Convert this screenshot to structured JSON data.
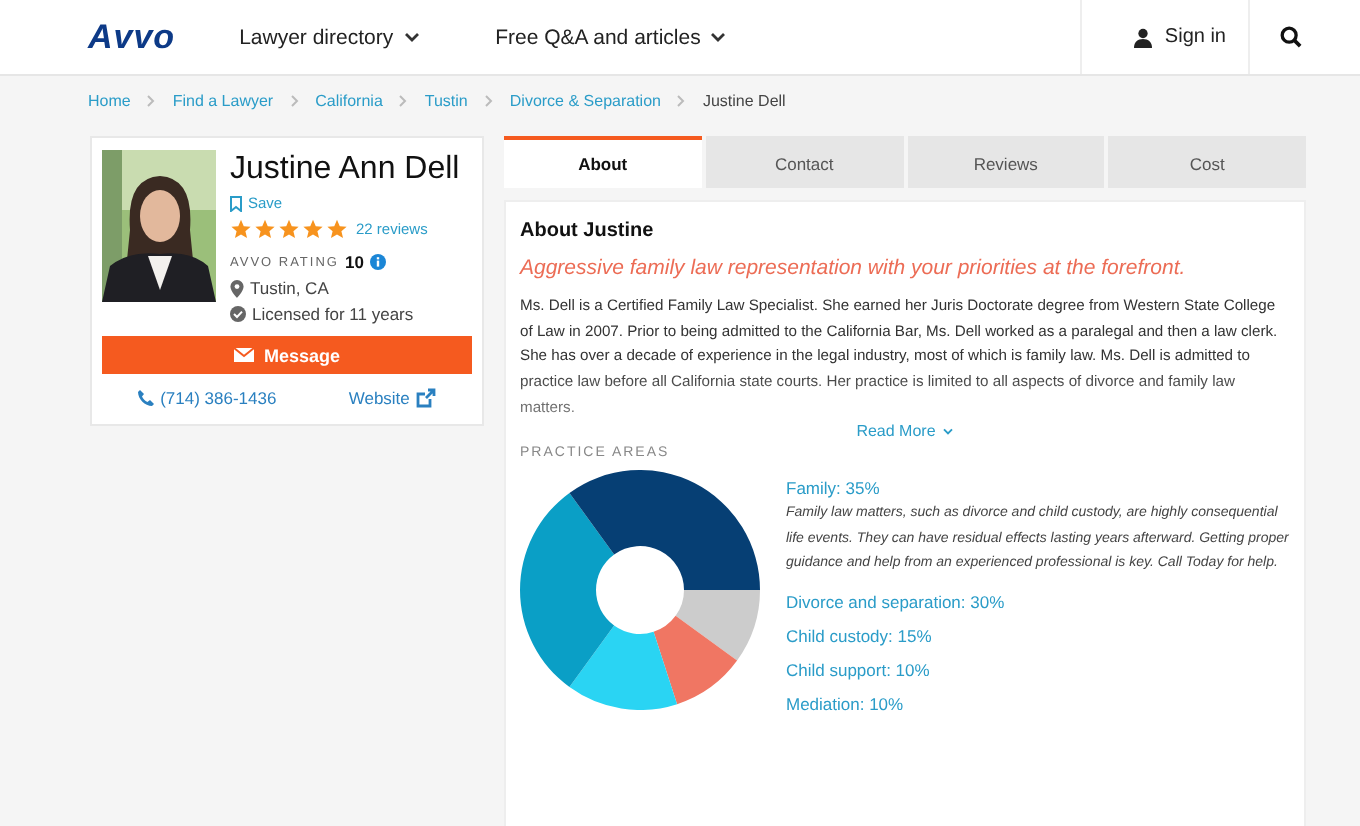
{
  "header": {
    "logo": "Avvo",
    "nav": [
      {
        "label": "Lawyer directory"
      },
      {
        "label": "Free Q&A and articles"
      }
    ],
    "sign_in": "Sign in"
  },
  "breadcrumb": [
    "Home",
    "Find a Lawyer",
    "California",
    "Tustin",
    "Divorce & Separation",
    "Justine Dell"
  ],
  "profile": {
    "name": "Justine Ann Dell",
    "save": "Save",
    "stars": 5,
    "reviews": "22 reviews",
    "rating_label": "AVVO RATING",
    "rating": "10",
    "location": "Tustin, CA",
    "licensed": "Licensed for 11 years",
    "message": "Message",
    "phone": "(714) 386-1436",
    "website": "Website"
  },
  "tabs": [
    {
      "label": "About",
      "selected": true
    },
    {
      "label": "Contact",
      "selected": false
    },
    {
      "label": "Reviews",
      "selected": false
    },
    {
      "label": "Cost",
      "selected": false
    }
  ],
  "about": {
    "heading": "About Justine",
    "tagline": "Aggressive family law representation with your priorities at the forefront.",
    "bio": "Ms. Dell is a Certified Family Law Specialist.  She earned her Juris Doctorate degree from Western State College of Law in 2007.  Prior to being admitted to the California Bar, Ms. Dell worked as a paralegal and then a law clerk.  She has over a decade of experience in the legal industry, most of which is family law.  Ms. Dell is admitted to practice law before all California state courts.  Her practice is limited to all aspects of divorce and family law matters.",
    "read_more": "Read More"
  },
  "practice_areas": {
    "heading": "PRACTICE AREAS",
    "description": "Family law matters, such as divorce and child custody, are highly consequential life events. They can have residual effects lasting years afterward. Getting proper guidance and help from an experienced professional is key. Call Today for help.",
    "chart_data": {
      "type": "donut",
      "categories": [
        "Family: 35%",
        "Divorce and separation: 30%",
        "Child custody: 15%",
        "Child support: 10%",
        "Mediation: 10%"
      ],
      "values": [
        35,
        30,
        15,
        10,
        10
      ]
    }
  }
}
